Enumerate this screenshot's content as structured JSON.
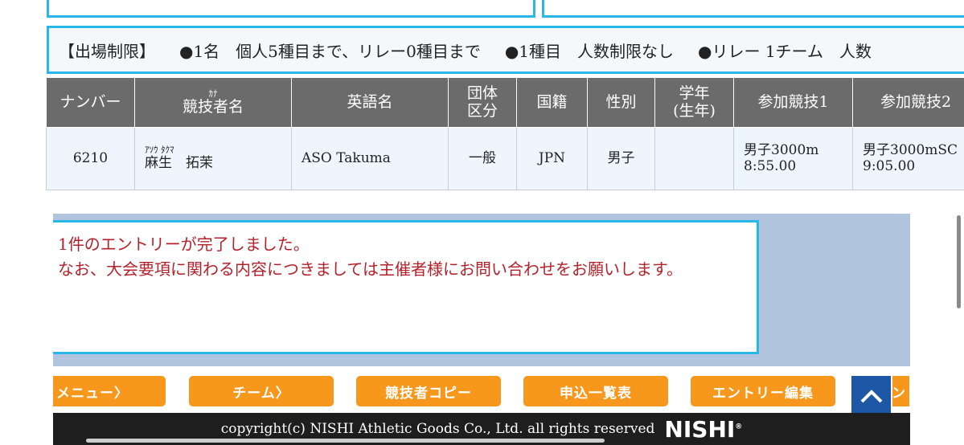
{
  "restrictions": {
    "label": "【出場制限】",
    "per_person": "●1名　個人5種目まで、リレー0種目まで",
    "per_event": "●1種目　人数制限なし",
    "relay": "●リレー 1チーム　人数"
  },
  "table": {
    "headers": {
      "number": "ナンバー",
      "name_kana": "ｶﾅ",
      "name": "競技者名",
      "english_name": "英語名",
      "category": "団体区分",
      "nationality": "国籍",
      "gender": "性別",
      "grade": "学年(生年)",
      "event1": "参加競技1",
      "event2": "参加競技2"
    },
    "rows": [
      {
        "number": "6210",
        "name_kana": "ｱｿｳ ﾀｸﾏ",
        "name": "麻生　拓茉",
        "english_name": "ASO Takuma",
        "category": "一般",
        "nationality": "JPN",
        "gender": "男子",
        "grade": "",
        "event1_name": "男子3000m",
        "event1_time": "8:55.00",
        "event2_name": "男子3000mSC",
        "event2_time": "9:05.00"
      }
    ]
  },
  "message": {
    "line1": "1件のエントリーが完了しました。",
    "line2": "なお、大会要項に関わる内容につきましては主催者様にお問い合わせをお願いします。"
  },
  "nav": {
    "menu": "メニュー〉",
    "team": "チーム〉",
    "athlete_copy": "競技者コピー",
    "application_list": "申込一覧表",
    "entry_edit": "エントリー編集",
    "partial": "ン"
  },
  "footer": {
    "copyright": "copyright(c) NISHI Athletic Goods Co., Ltd. all rights reserved",
    "logo": "NISHI"
  },
  "colors": {
    "accent_border": "#29b6e8",
    "header_bg": "#6b6b6b",
    "nav_button": "#f7971b",
    "message_text": "#b5212a",
    "scroll_top_button": "#1d57a5"
  }
}
